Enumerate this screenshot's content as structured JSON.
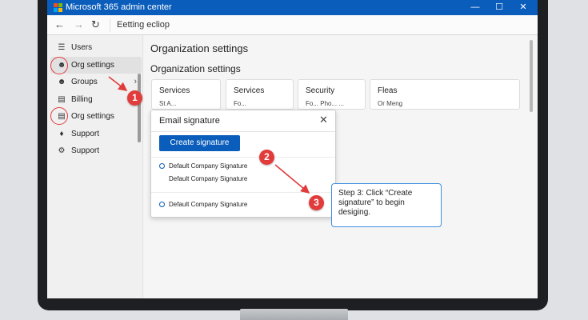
{
  "window": {
    "title": "Microsoft 365 admin center",
    "minimize": "—",
    "maximize": "☐",
    "close": "✕"
  },
  "navbar": {
    "back": "←",
    "forward": "→",
    "refresh": "↻",
    "address": "Eetting ecliop"
  },
  "sidebar": {
    "items": [
      {
        "label": "Users",
        "icon": "list-icon"
      },
      {
        "label": "Org settings",
        "icon": "person-icon"
      },
      {
        "label": "Groups",
        "icon": "person-icon"
      },
      {
        "label": "Billing",
        "icon": "billing-icon"
      },
      {
        "label": "Org settings",
        "icon": "message-icon"
      },
      {
        "label": "Support",
        "icon": "support-icon"
      },
      {
        "label": "Support",
        "icon": "settings-icon"
      }
    ],
    "groups_chevron": "›"
  },
  "main": {
    "page_title": "Organization settings",
    "section_title": "Organization settings",
    "cards": [
      {
        "title": "Services",
        "sub": "St A..."
      },
      {
        "title": "Services",
        "sub": "Fo..."
      },
      {
        "title": "Security",
        "sub": "Fo... Pho... ..."
      },
      {
        "title": "Fleas",
        "sub": "Or Meng"
      }
    ]
  },
  "dialog": {
    "title": "Email signature",
    "close": "✕",
    "create_button": "Create signature",
    "signatures": [
      "Default Company Signature",
      "Default Company Signature",
      "Default Company Signature"
    ]
  },
  "annotations": {
    "badges": [
      "1",
      "2",
      "3"
    ],
    "callout": "Step 3: Click “Create signature” to begin desiging."
  },
  "colors": {
    "brand_blue": "#0a5dbb",
    "annotation_red": "#e23b3b",
    "callout_border": "#3f8fe0"
  }
}
